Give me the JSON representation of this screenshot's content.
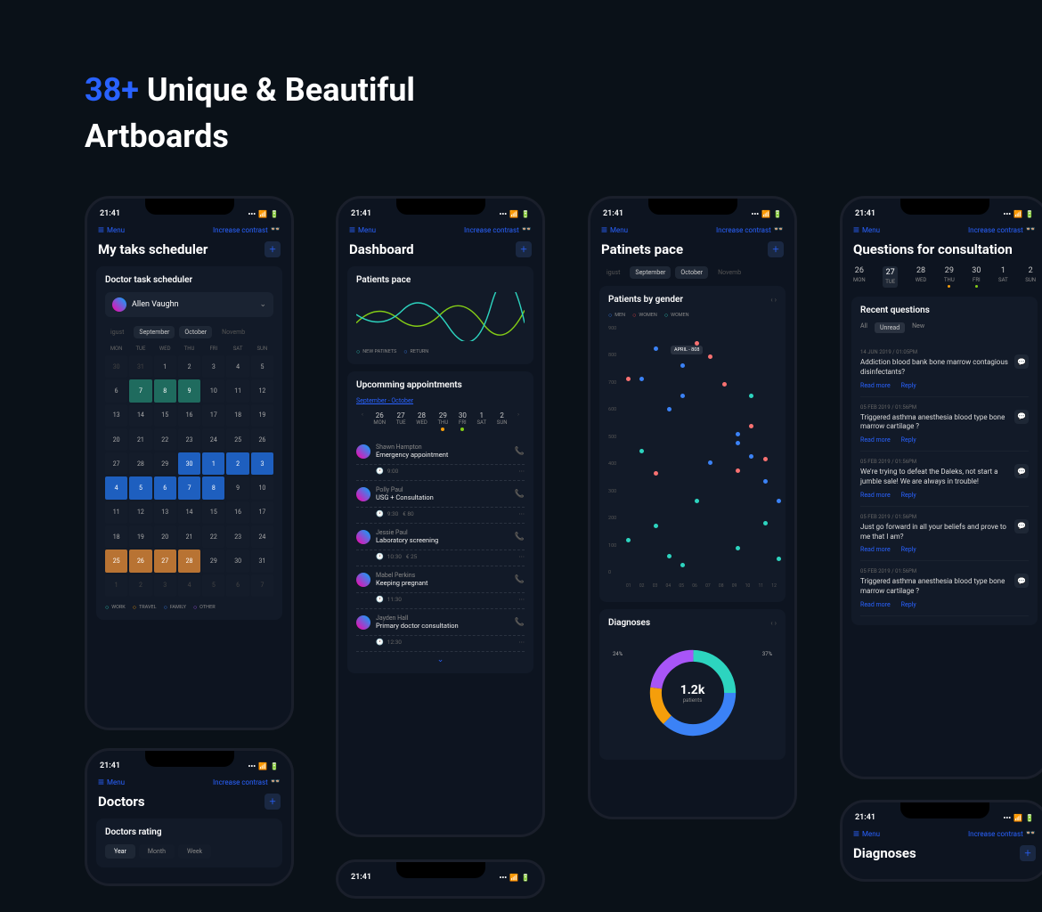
{
  "headline": {
    "accent": "38+",
    "rest": " Unique & Beautiful",
    "line2": "Artboards"
  },
  "status": {
    "time": "21:41"
  },
  "topbar": {
    "menu": "Menu",
    "contrast": "Increase contrast"
  },
  "scheduler": {
    "title": "My taks scheduler",
    "cardTitle": "Doctor task scheduler",
    "doctor": "Allen Vaughn",
    "months": [
      "igust",
      "September",
      "October",
      "Novemb"
    ],
    "days": [
      "MON",
      "TUE",
      "WED",
      "THU",
      "FRI",
      "SAT",
      "SUN"
    ],
    "legend": {
      "work": "WORK",
      "travel": "TRAVEL",
      "family": "FAMILY",
      "other": "OTHER"
    }
  },
  "dashboard": {
    "title": "Dashboard",
    "paceTitle": "Patients pace",
    "legend": {
      "new": "NEW PATINETS",
      "return": "RETURN"
    },
    "upTitle": "Upcomming appointments",
    "upRange": "September - October",
    "strip": [
      {
        "n": "26",
        "d": "MON"
      },
      {
        "n": "27",
        "d": "TUE"
      },
      {
        "n": "28",
        "d": "WED"
      },
      {
        "n": "29",
        "d": "THU"
      },
      {
        "n": "30",
        "d": "FRI"
      },
      {
        "n": "1",
        "d": "SAT"
      },
      {
        "n": "2",
        "d": "SUN"
      }
    ],
    "appts": [
      {
        "name": "Shawn Hampton",
        "desc": "Emergency appointment",
        "time": "9:00",
        "price": ""
      },
      {
        "name": "Polly Paul",
        "desc": "USG + Consultation",
        "time": "9:30",
        "price": "€  80"
      },
      {
        "name": "Jessie Paul",
        "desc": "Laboratory screening",
        "time": "10:30",
        "price": "€  25"
      },
      {
        "name": "Mabel Perkins",
        "desc": "Keeping pregnant",
        "time": "11:30",
        "price": ""
      },
      {
        "name": "Jayden Hall",
        "desc": "Primary doctor consultation",
        "time": "12:30",
        "price": ""
      }
    ]
  },
  "pace": {
    "title": "Patinets pace",
    "genderTitle": "Patients by gender",
    "legend": {
      "men": "MEN",
      "women1": "WOMEN",
      "women2": "WOMEN"
    },
    "tooltip": "APRIL - 808",
    "yticks": [
      "900",
      "800",
      "700",
      "600",
      "500",
      "400",
      "300",
      "200",
      "100",
      "0"
    ],
    "xticks": [
      "01",
      "02",
      "03",
      "04",
      "05",
      "06",
      "07",
      "08",
      "09",
      "10",
      "11",
      "12"
    ],
    "diagTitle": "Diagnoses",
    "donut": {
      "center": "1.2k",
      "label": "patients",
      "left": "24%",
      "right": "37%"
    }
  },
  "questions": {
    "title": "Questions for consultation",
    "dates": [
      {
        "n": "26",
        "d": "MON"
      },
      {
        "n": "27",
        "d": "TUE"
      },
      {
        "n": "28",
        "d": "WED"
      },
      {
        "n": "29",
        "d": "THU"
      },
      {
        "n": "30",
        "d": "FRI"
      },
      {
        "n": "1",
        "d": "SAT"
      },
      {
        "n": "2",
        "d": "SUN"
      }
    ],
    "recentTitle": "Recent questions",
    "filters": {
      "all": "All",
      "unread": "Unread",
      "new": "New"
    },
    "items": [
      {
        "meta": "14 JUN 2019  /  01:05PM",
        "text": "Addiction blood bank bone marrow contagious disinfectants?"
      },
      {
        "meta": "05 FEB 2019  /  01:56PM",
        "text": "Triggered asthma anesthesia blood type bone marrow cartilage ?"
      },
      {
        "meta": "05 FEB 2019  /  01:56PM",
        "text": "We're trying to defeat the Daleks, not start a jumble sale! We are always in trouble!"
      },
      {
        "meta": "05 FEB 2019  /  01:56PM",
        "text": "Just go forward in all your beliefs and prove to me that I am?"
      },
      {
        "meta": "05 FEB 2019  /  01:56PM",
        "text": "Triggered asthma anesthesia blood type bone marrow cartilage ?"
      }
    ],
    "readmore": "Read more",
    "reply": "Reply"
  },
  "doctors": {
    "title": "Doctors",
    "ratingTitle": "Doctors rating",
    "tabs": {
      "year": "Year",
      "month": "Month",
      "week": "Week"
    }
  },
  "diag2": {
    "title": "Diagnoses"
  },
  "chart_data": {
    "type": "scatter",
    "title": "Patients by gender",
    "xlabel": "",
    "ylabel": "",
    "xticks": [
      "01",
      "02",
      "03",
      "04",
      "05",
      "06",
      "07",
      "08",
      "09",
      "10",
      "11",
      "12"
    ],
    "ylim": [
      0,
      900
    ],
    "series": [
      {
        "name": "MEN",
        "color": "#3b82f6",
        "points": [
          [
            2,
            700
          ],
          [
            3,
            810
          ],
          [
            4,
            590
          ],
          [
            5,
            640
          ],
          [
            5,
            750
          ],
          [
            7,
            400
          ],
          [
            9,
            470
          ],
          [
            9,
            500
          ],
          [
            10,
            420
          ],
          [
            11,
            330
          ],
          [
            12,
            260
          ]
        ]
      },
      {
        "name": "WOMEN",
        "color": "#f87171",
        "points": [
          [
            1,
            700
          ],
          [
            3,
            360
          ],
          [
            6,
            830
          ],
          [
            7,
            780
          ],
          [
            8,
            680
          ],
          [
            9,
            370
          ],
          [
            10,
            530
          ],
          [
            11,
            410
          ]
        ]
      },
      {
        "name": "WOMEN",
        "color": "#2dd4bf",
        "points": [
          [
            1,
            120
          ],
          [
            2,
            440
          ],
          [
            3,
            170
          ],
          [
            4,
            60
          ],
          [
            5,
            30
          ],
          [
            6,
            260
          ],
          [
            9,
            90
          ],
          [
            10,
            640
          ],
          [
            11,
            180
          ],
          [
            12,
            50
          ]
        ]
      }
    ]
  }
}
